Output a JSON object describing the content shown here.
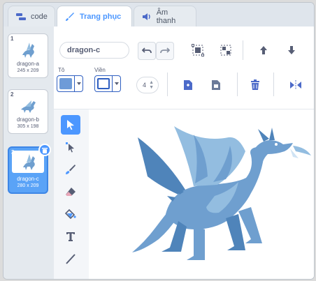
{
  "tabs": [
    {
      "label": "code",
      "icon": "code-icon"
    },
    {
      "label": "Trang phục",
      "icon": "brush-icon"
    },
    {
      "label": "Âm thanh",
      "icon": "speaker-icon"
    }
  ],
  "costumes": [
    {
      "number": "1",
      "name": "dragon-a",
      "size": "245 x 209"
    },
    {
      "number": "2",
      "name": "dragon-b",
      "size": "305 x 198"
    },
    {
      "number": "3",
      "name": "dragon-c",
      "size": "280 x 209"
    }
  ],
  "editor": {
    "costume_name": "dragon-c",
    "fill_label": "Tô",
    "outline_label": "Viền",
    "outline_width": "4"
  },
  "colors": {
    "accent": "#4c97ff",
    "fill_swatch": "#6e9bd8",
    "outline_swatch": "#ffffff",
    "dragon_main": "#6f9fcf",
    "dragon_wing": "#93bde0",
    "dragon_dark": "#4f84ba"
  },
  "tools": [
    "select-tool",
    "reshape-tool",
    "brush-tool",
    "eraser-tool",
    "fill-tool",
    "text-tool",
    "line-tool"
  ]
}
